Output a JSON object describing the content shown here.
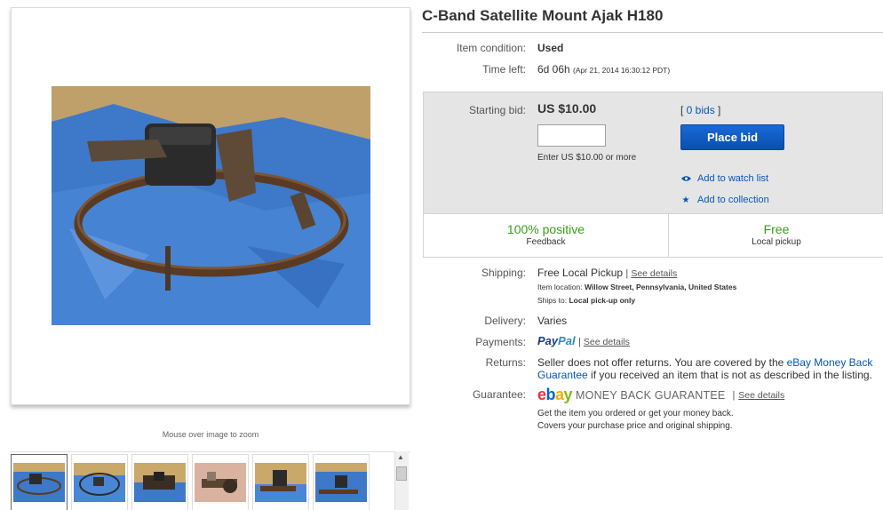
{
  "gallery": {
    "zoom_hint": "Mouse over image to zoom",
    "thumbnail_count": 6
  },
  "item": {
    "title": "C-Band Satellite Mount Ajak H180"
  },
  "condition": {
    "label": "Item condition:",
    "value": "Used"
  },
  "time_left": {
    "label": "Time left:",
    "value": "6d 06h",
    "detail": "(Apr 21, 2014  16:30:12 PDT)"
  },
  "bid": {
    "label": "Starting bid:",
    "price": "US $10.00",
    "input_value": "",
    "hint": "Enter US $10.00 or more",
    "bids_count": "0 bids",
    "place_bid": "Place bid",
    "watch": "Add to watch list",
    "collection": "Add to collection"
  },
  "stats": {
    "feedback_value": "100% positive",
    "feedback_label": "Feedback",
    "pickup_value": "Free",
    "pickup_label": "Local pickup"
  },
  "shipping": {
    "label": "Shipping:",
    "value": "Free Local Pickup",
    "see_details": "See details",
    "location_label": "Item location:",
    "location": "Willow Street, Pennsylvania, United States",
    "ships_label": "Ships to:",
    "ships_to": "Local pick-up only"
  },
  "delivery": {
    "label": "Delivery:",
    "value": "Varies"
  },
  "payments": {
    "label": "Payments:",
    "paypal_pay": "Pay",
    "paypal_pal": "Pal",
    "see_details": "See details"
  },
  "returns": {
    "label": "Returns:",
    "text_before": "Seller does not offer returns. You are covered by the ",
    "link_line1": "eBay Money Back",
    "link_line2": "Guarantee",
    "text_after": " if you received an item that is not as described in the listing."
  },
  "guarantee": {
    "label": "Guarantee:",
    "logo": {
      "e": "e",
      "b": "b",
      "a": "a",
      "y": "y"
    },
    "mbg": "MONEY BACK GUARANTEE",
    "see_details": "See details",
    "line1": "Get the item you ordered or get your money back.",
    "line2": "Covers your purchase price and original shipping."
  },
  "colors": {
    "link": "#0654ba",
    "button": "#0a4fb0",
    "positive": "#3a9c1c",
    "panel": "#e5e5e5"
  }
}
